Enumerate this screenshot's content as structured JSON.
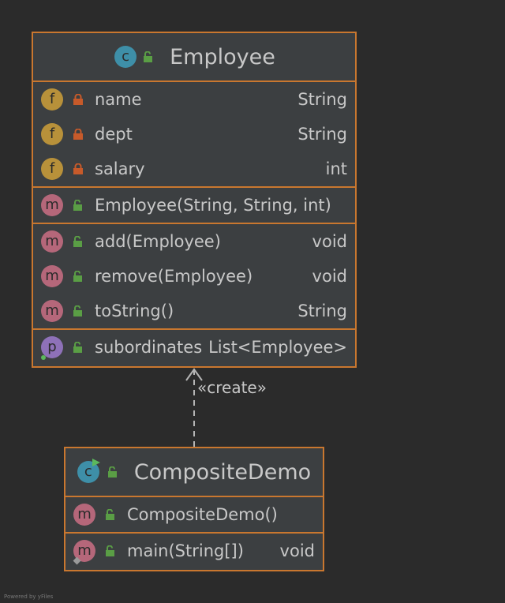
{
  "diagram": {
    "employee": {
      "title": "Employee",
      "fields": [
        {
          "name": "name",
          "type": "String"
        },
        {
          "name": "dept",
          "type": "String"
        },
        {
          "name": "salary",
          "type": "int"
        }
      ],
      "constructors": [
        {
          "name": "Employee(String, String, int)",
          "type": ""
        }
      ],
      "methods": [
        {
          "name": "add(Employee)",
          "type": "void"
        },
        {
          "name": "remove(Employee)",
          "type": "void"
        },
        {
          "name": "toString()",
          "type": "String"
        }
      ],
      "properties": [
        {
          "name": "subordinates",
          "type": "List<Employee>"
        }
      ]
    },
    "demo": {
      "title": "CompositeDemo",
      "constructors": [
        {
          "name": "CompositeDemo()",
          "type": ""
        }
      ],
      "methods": [
        {
          "name": "main(String[])",
          "type": "void"
        }
      ]
    },
    "relation_label": "«create»",
    "badges": {
      "field": "f",
      "method": "m",
      "property": "p",
      "class": "c"
    },
    "colors": {
      "background": "#2b2b2b",
      "box": "#3c3f41",
      "border": "#c9772f",
      "field_badge": "#b8913a",
      "method_badge": "#b5677a",
      "property_badge": "#8e71b8",
      "class_badge": "#3e8fa8",
      "lock_private": "#c75a2a",
      "lock_public": "#5a9e45"
    },
    "footer": "Powered by yFiles"
  }
}
